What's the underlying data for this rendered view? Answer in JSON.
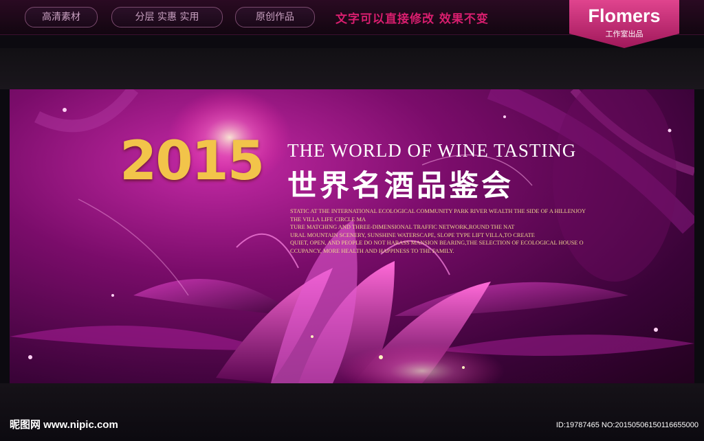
{
  "top_bar": {
    "tags": [
      "高清素材",
      "分层 实惠 实用",
      "原创作品"
    ],
    "slogan": "文字可以直接修改  效果不变"
  },
  "brand_badge": {
    "title": "Flomers",
    "subtitle": "工作室出品"
  },
  "banner": {
    "year": "2015",
    "title_en": "THE WORLD OF WINE TASTING",
    "title_cn": "世界名酒品鉴会",
    "body_lines": [
      "STATIC AT THE INTERNATIONAL ECOLOGICAL COMMUNITY PARK RIVER WEALTH THE SIDE OF A HILLENJOY",
      "THE VILLA LIFE CIRCLE MA",
      "TURE MATCHING AND THREE-DIMENSIONAL TRAFFIC NETWORK,ROUND THE NAT",
      "URAL MOUNTAIN SCENERY, SUNSHINE WATERSCAPE, SLOPE TYPE LIFT VILLA,TO CREATE",
      "QUIET, OPEN, AND PEOPLE DO NOT HARASS MANSION BEARING,THE SELECTION OF ECOLOGICAL HOUSE O",
      "CCUPANCY, MORE HEALTH AND HAPPINESS TO THE FAMILY."
    ]
  },
  "footer": {
    "site": "昵图网 www.nipic.com",
    "image_id": "ID:19787465 NO:20150506150116655000"
  },
  "colors": {
    "accent_pink": "#d81e6e",
    "banner_magenta": "#9a1a86",
    "gold": "#f2c44a"
  }
}
